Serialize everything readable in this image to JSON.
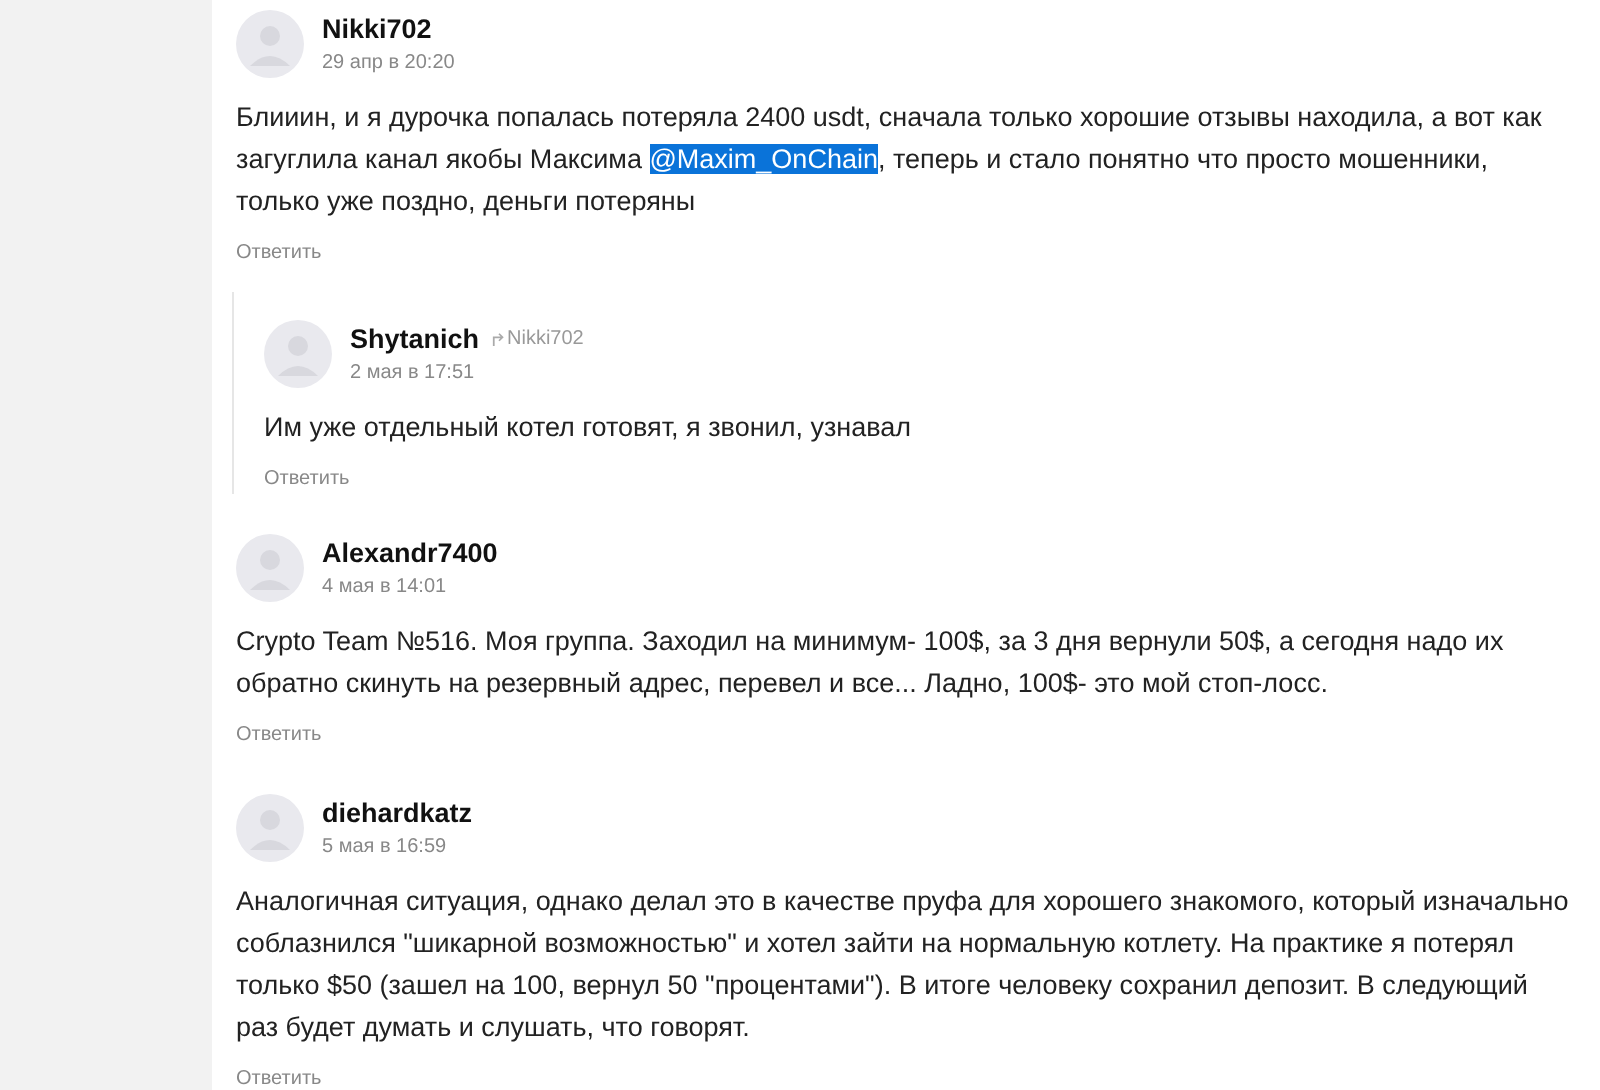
{
  "comments": [
    {
      "author": "Nikki702",
      "date": "29 апр в 20:20",
      "text_before": "Блииин, и я дурочка попалась потеряла 2400 usdt, сначала только хорошие отзывы находила, а вот как загуглила канал якобы Максима ",
      "mention": {
        "text": "@Maxim_OnChain",
        "selected": true
      },
      "text_after": ", теперь и стало понятно что просто мошенники, только уже поздно, деньги потеряны",
      "reply_label": "Ответить",
      "replies": [
        {
          "author": "Shytanich",
          "reply_to": "Nikki702",
          "date": "2 мая в 17:51",
          "text": "Им уже отдельный котел готовят, я звонил, узнавал",
          "reply_label": "Ответить"
        }
      ]
    },
    {
      "author": "Alexandr7400",
      "date": "4 мая в 14:01",
      "text": "Crypto Team №516. Моя группа. Заходил на минимум- 100$, за 3 дня вернули 50$, а сегодня надо их обратно скинуть на резервный адрес, перевел и все... Ладно, 100$- это мой стоп-лосс.",
      "reply_label": "Ответить"
    },
    {
      "author": "diehardkatz",
      "date": "5 мая в 16:59",
      "text": "Аналогичная ситуация, однако делал это в качестве пруфа для хорошего знакомого, который изначально соблазнился \"шикарной возможностью\" и хотел зайти на нормальную котлету. На практике я потерял только $50 (зашел на 100, вернул 50 \"процентами\"). В итоге человеку сохранил депозит. В следующий раз будет думать и слушать, что говорят.",
      "reply_label": "Ответить"
    }
  ]
}
